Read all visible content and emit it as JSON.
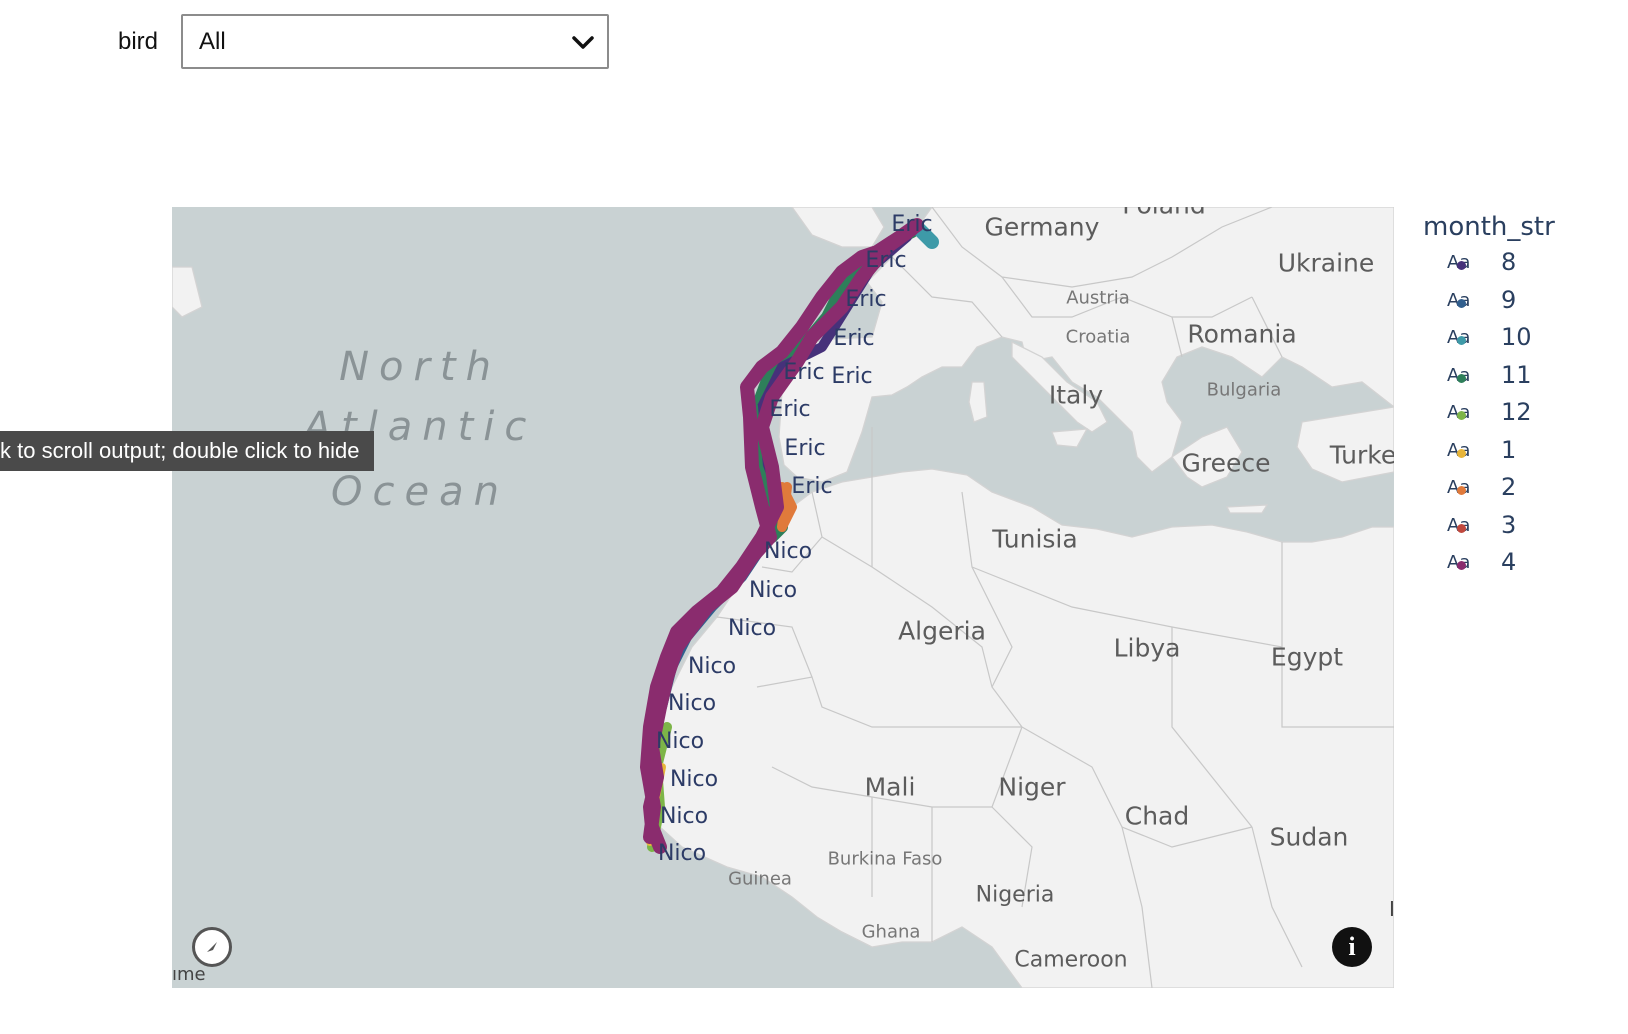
{
  "filter": {
    "label": "bird",
    "selected": "All"
  },
  "tooltip": "k to scroll output; double click to hide",
  "map": {
    "ocean_label": [
      "North",
      "Atlantic",
      "Ocean"
    ],
    "countries": [
      {
        "name": "Poland"
      },
      {
        "name": "Germany"
      },
      {
        "name": "Ukraine"
      },
      {
        "name": "Austria"
      },
      {
        "name": "Croatia"
      },
      {
        "name": "Romania"
      },
      {
        "name": "Italy"
      },
      {
        "name": "Bulgaria"
      },
      {
        "name": "Greece"
      },
      {
        "name": "Turke"
      },
      {
        "name": "Tunisia"
      },
      {
        "name": "Algeria"
      },
      {
        "name": "Libya"
      },
      {
        "name": "Egypt"
      },
      {
        "name": "Mali"
      },
      {
        "name": "Niger"
      },
      {
        "name": "Chad"
      },
      {
        "name": "Sudan"
      },
      {
        "name": "Burkina Faso"
      },
      {
        "name": "Guinea"
      },
      {
        "name": "Nigeria"
      },
      {
        "name": "Ghana"
      },
      {
        "name": "Cameroon"
      }
    ],
    "attribution_fragment": "ıme",
    "edge_mark": "I",
    "trace_labels": [
      "Eric",
      "Eric",
      "Eric",
      "Eric",
      "Eric",
      "Eric",
      "Eric",
      "Eric",
      "Eric",
      "Nico",
      "Nico",
      "Nico",
      "Nico",
      "Nico",
      "Nico",
      "Nico",
      "Nico",
      "Nico"
    ]
  },
  "legend": {
    "title": "month_str",
    "symbol": "Aa",
    "items": [
      {
        "label": "8",
        "color": "#46317a"
      },
      {
        "label": "9",
        "color": "#315f8e"
      },
      {
        "label": "10",
        "color": "#3e9aa8"
      },
      {
        "label": "11",
        "color": "#2e7f5a"
      },
      {
        "label": "12",
        "color": "#7db548"
      },
      {
        "label": "1",
        "color": "#e7b53a"
      },
      {
        "label": "2",
        "color": "#e07a3b"
      },
      {
        "label": "3",
        "color": "#c0483d"
      },
      {
        "label": "4",
        "color": "#8a2c6e"
      }
    ]
  }
}
